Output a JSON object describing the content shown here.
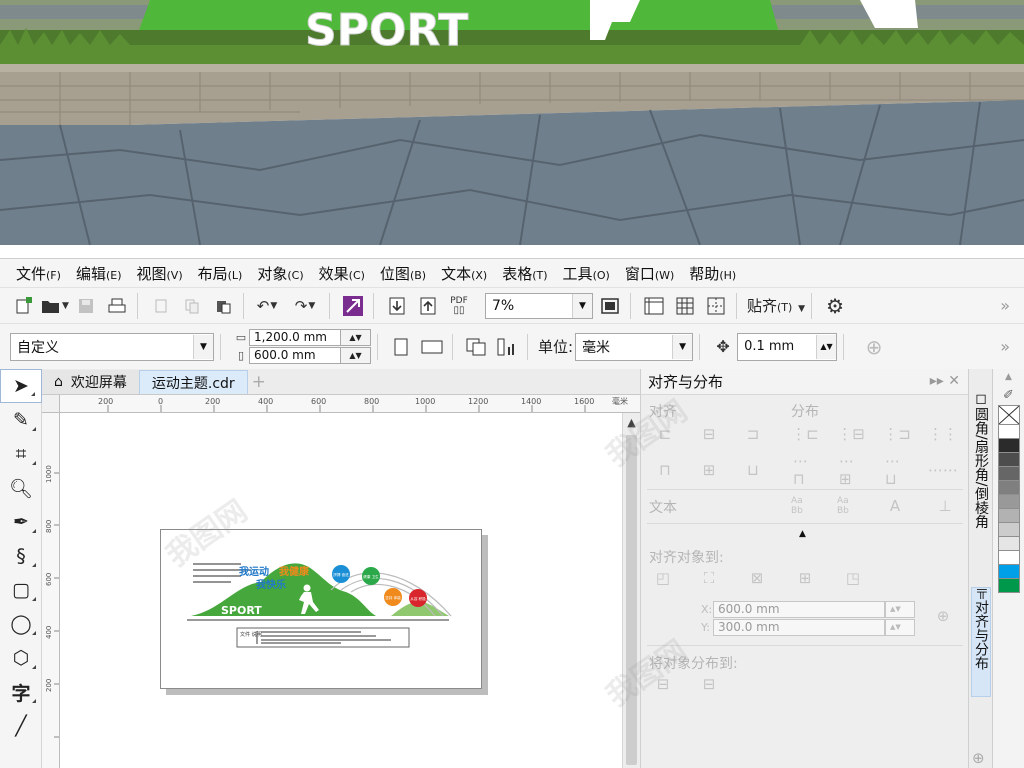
{
  "photo": {
    "sign_text": "SPORT"
  },
  "menubar": {
    "items": [
      {
        "label": "文件",
        "accel": "(F)"
      },
      {
        "label": "编辑",
        "accel": "(E)"
      },
      {
        "label": "视图",
        "accel": "(V)"
      },
      {
        "label": "布局",
        "accel": "(L)"
      },
      {
        "label": "对象",
        "accel": "(C)"
      },
      {
        "label": "效果",
        "accel": "(C)"
      },
      {
        "label": "位图",
        "accel": "(B)"
      },
      {
        "label": "文本",
        "accel": "(X)"
      },
      {
        "label": "表格",
        "accel": "(T)"
      },
      {
        "label": "工具",
        "accel": "(O)"
      },
      {
        "label": "窗口",
        "accel": "(W)"
      },
      {
        "label": "帮助",
        "accel": "(H)"
      }
    ]
  },
  "toolbar1": {
    "pdf_label": "PDF",
    "zoom_value": "7%",
    "snap_label": "贴齐",
    "snap_accel": "(T)"
  },
  "toolbar2": {
    "preset_value": "自定义",
    "width_value": "1,200.0 mm",
    "height_value": "600.0 mm",
    "units_label": "单位:",
    "units_value": "毫米",
    "nudge_value": "0.1 mm"
  },
  "doc_tabs": {
    "welcome": "欢迎屏幕",
    "document": "运动主题.cdr"
  },
  "ruler": {
    "ticks": [
      "200",
      "0",
      "200",
      "400",
      "600",
      "800",
      "1000",
      "1200",
      "1400",
      "1600"
    ],
    "unit": "毫米",
    "v_ticks": [
      "1000",
      "800",
      "600",
      "400",
      "200"
    ]
  },
  "artwork": {
    "slogan_1": "我运动",
    "slogan_2": "我健康",
    "slogan_3": "我快乐",
    "sport": "SPORT",
    "bubbles": [
      "拼搏 奋进",
      "健康 卫生",
      "坚持 体能",
      "从容 积极"
    ],
    "bubble_colors": [
      "#1a8fd6",
      "#2aa84a",
      "#f08a1c",
      "#d9262c"
    ],
    "box_label": "文件 说明"
  },
  "docker": {
    "title": "对齐与分布",
    "align_label": "对齐",
    "distribute_label": "分布",
    "text_label": "文本",
    "align_to_label": "对齐对象到:",
    "x_label": "X:",
    "x_value": "600.0 mm",
    "y_label": "Y:",
    "y_value": "300.0 mm",
    "distribute_to_label": "将对象分布到:",
    "text_icons": [
      "Aa Bb",
      "Aa Bb",
      "A"
    ]
  },
  "side_tabs": {
    "tab1": "圆角/扇形角/倒棱角",
    "tab2": "对齐与分布"
  },
  "palette": {
    "colors": [
      "#ffffff",
      "#2b2b2b",
      "#4d4d4d",
      "#666666",
      "#7f7f7f",
      "#999999",
      "#b2b2b2",
      "#cccccc",
      "#e5e5e5",
      "#ffffff",
      "#00a0e9",
      "#00994c"
    ]
  },
  "watermark": "我图网"
}
